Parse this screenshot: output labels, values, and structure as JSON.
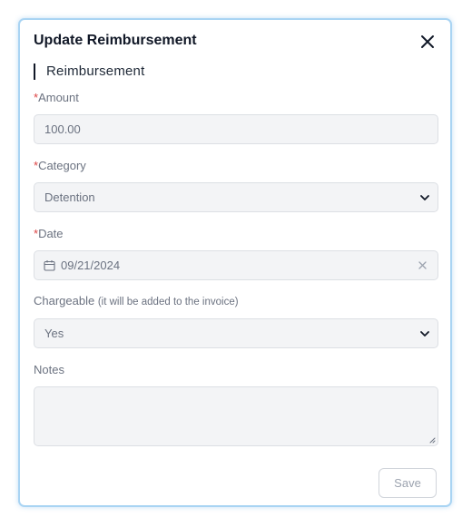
{
  "dialog": {
    "title": "Update Reimbursement",
    "section_heading": "Reimbursement"
  },
  "form": {
    "amount": {
      "required_mark": "*",
      "label": "Amount",
      "value": "100.00"
    },
    "category": {
      "required_mark": "*",
      "label": "Category",
      "value": "Detention"
    },
    "date": {
      "required_mark": "*",
      "label": "Date",
      "value": "09/21/2024"
    },
    "chargeable": {
      "label": "Chargeable",
      "hint": "(it will be added to the invoice)",
      "value": "Yes"
    },
    "notes": {
      "label": "Notes",
      "value": ""
    }
  },
  "actions": {
    "save_label": "Save"
  },
  "icons": {
    "close": "close-icon",
    "chevron": "chevron-down-icon",
    "calendar": "calendar-icon",
    "clear": "clear-icon",
    "resize": "resize-grip-icon"
  },
  "colors": {
    "required": "#dc4444",
    "border_accent": "#a9d4f3",
    "field_bg": "#f3f4f6"
  }
}
